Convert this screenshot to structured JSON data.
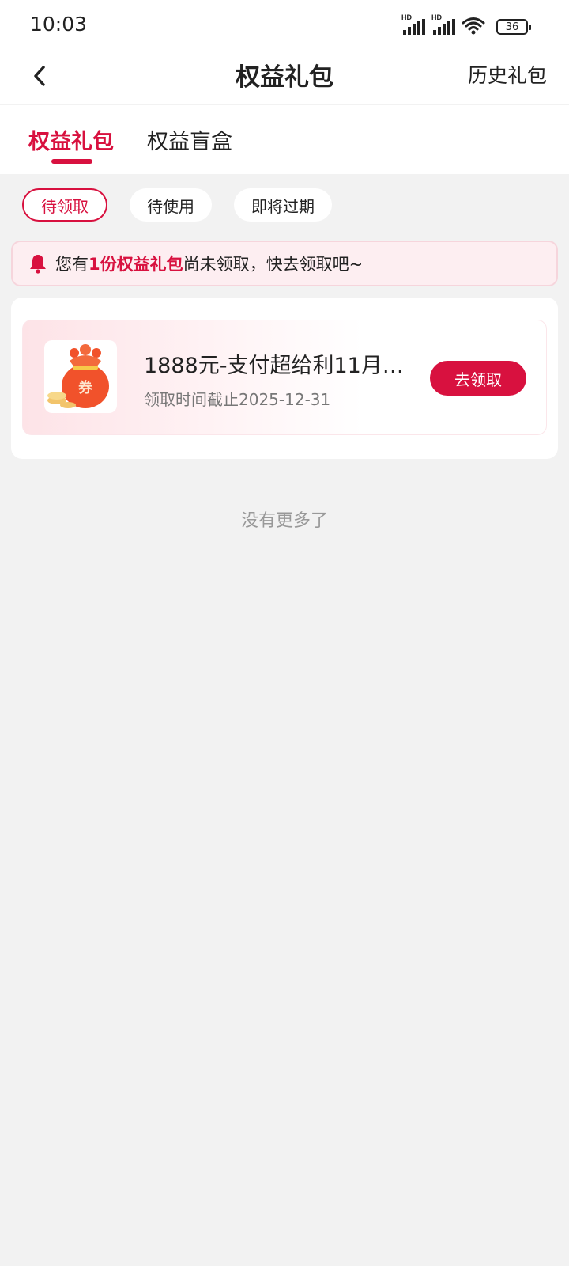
{
  "status": {
    "time": "10:03",
    "hd1": "HD",
    "hd2": "HD",
    "battery": "36"
  },
  "header": {
    "title": "权益礼包",
    "history": "历史礼包"
  },
  "tabs": [
    {
      "label": "权益礼包",
      "active": true
    },
    {
      "label": "权益盲盒",
      "active": false
    }
  ],
  "chips": [
    {
      "label": "待领取",
      "active": true
    },
    {
      "label": "待使用",
      "active": false
    },
    {
      "label": "即将过期",
      "active": false
    }
  ],
  "notice": {
    "prefix": "您有",
    "highlight": "1份权益礼包",
    "suffix": "尚未领取，快去领取吧~"
  },
  "card": {
    "title": "1888元-支付超给利11月…",
    "deadline": "领取时间截止2025-12-31",
    "button": "去领取",
    "bag_label": "券"
  },
  "footer": {
    "no_more": "没有更多了"
  },
  "colors": {
    "accent": "#d8113f",
    "background": "#f2f2f2"
  }
}
